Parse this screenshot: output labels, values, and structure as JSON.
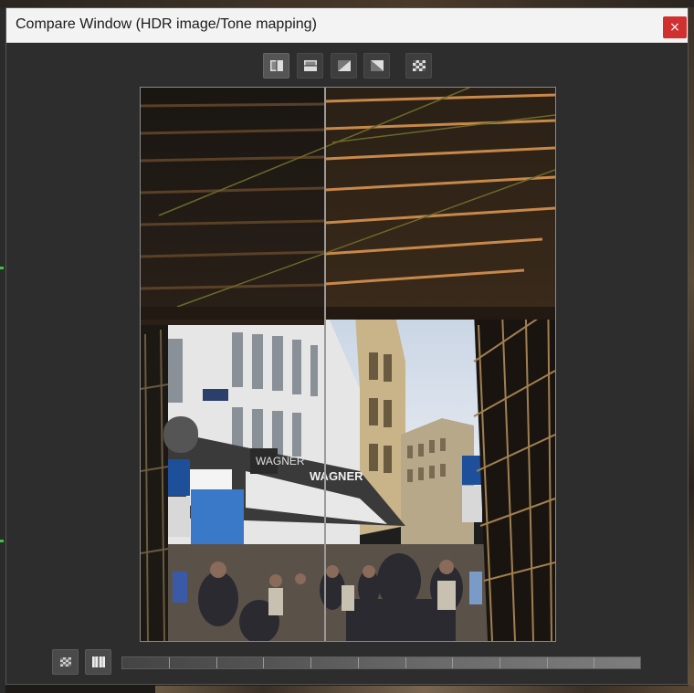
{
  "window": {
    "title": "Compare Window (HDR image/Tone mapping)",
    "close_glyph": "×",
    "close_color": "#d0302f"
  },
  "toolbar": {
    "buttons": [
      {
        "name": "split-vertical",
        "icon": "split-vertical-icon",
        "active": true
      },
      {
        "name": "split-horizontal",
        "icon": "split-horizontal-icon",
        "active": false
      },
      {
        "name": "split-diagonal-left",
        "icon": "diagonal-split-icon",
        "active": false
      },
      {
        "name": "split-diagonal-right",
        "icon": "diagonal-split-reverse-icon",
        "active": false
      },
      {
        "name": "checker",
        "icon": "checkerboard-icon",
        "active": false
      }
    ]
  },
  "viewer": {
    "split_fraction": 0.445,
    "sign_text": "WAGNER",
    "sign_text_left": "WAGNER"
  },
  "bottom": {
    "buttons": [
      {
        "name": "original",
        "icon": "checkerboard-small-icon"
      },
      {
        "name": "compare",
        "icon": "split-vertical-icon"
      }
    ],
    "slider_ticks": 11
  }
}
